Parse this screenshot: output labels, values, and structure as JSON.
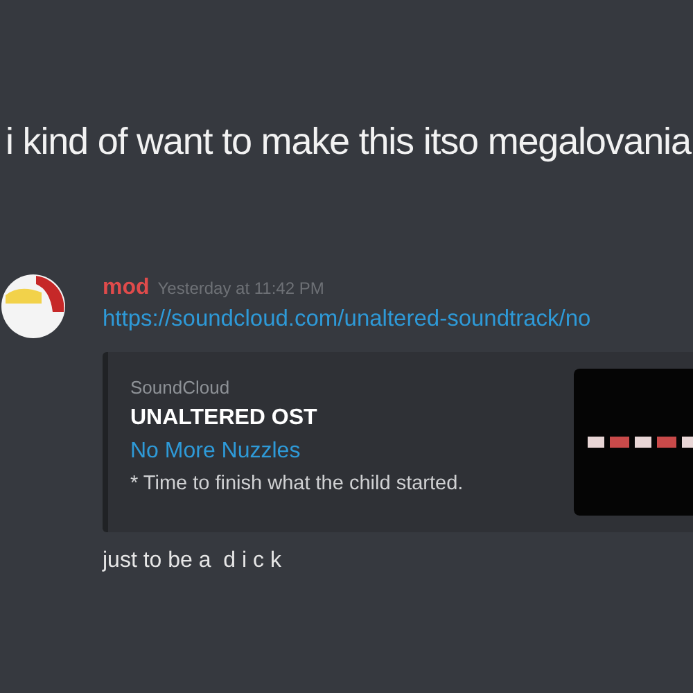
{
  "caption": "i kind of want to make this itso megalovania",
  "message": {
    "author": "mod",
    "timestamp": "Yesterday at 11:42 PM",
    "link": "https://soundcloud.com/unaltered-soundtrack/no",
    "embed": {
      "provider": "SoundCloud",
      "author": "UNALTERED OST",
      "title": "No More Nuzzles",
      "description": "* Time to finish what the child started."
    },
    "followup": "just to be a  d i c k"
  }
}
